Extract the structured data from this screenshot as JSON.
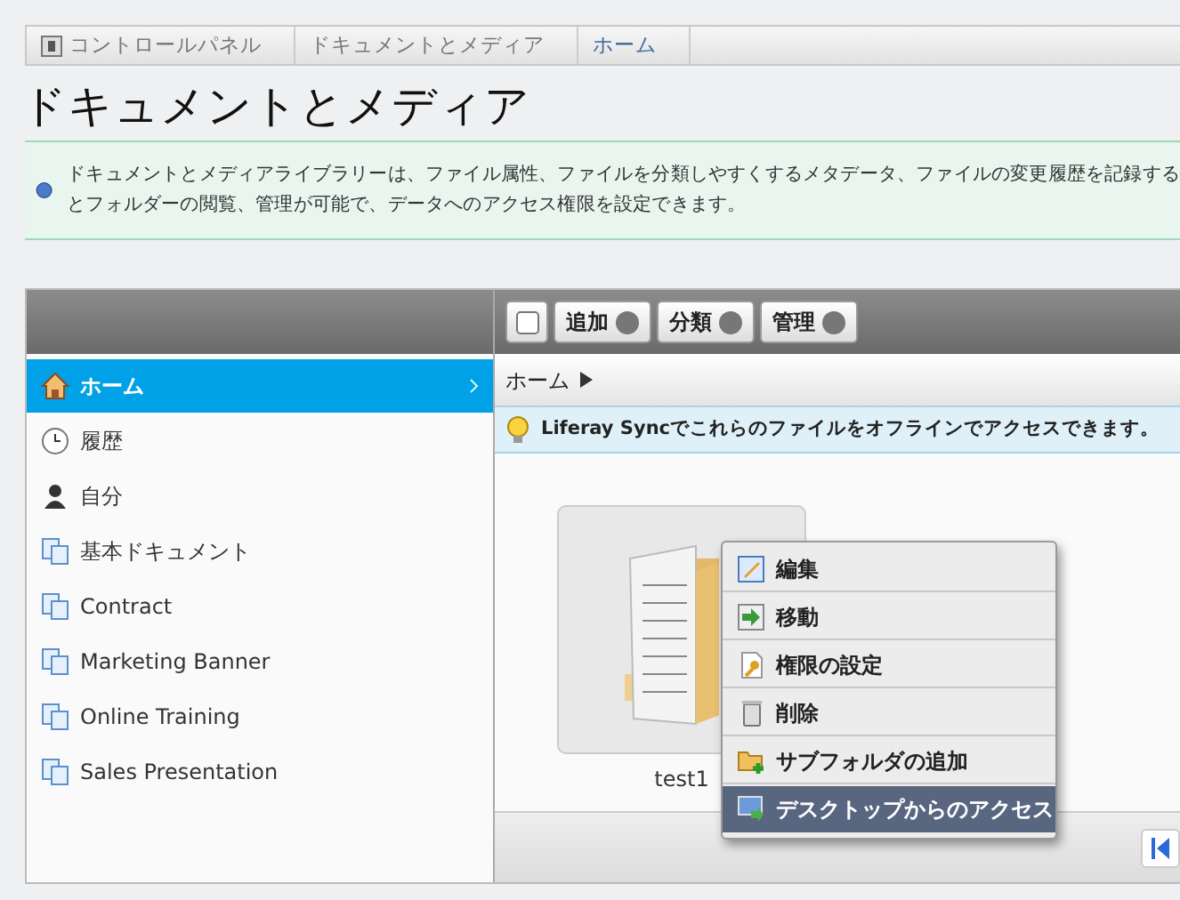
{
  "breadcrumb": [
    {
      "label": "コントロールパネル",
      "kind": "root",
      "current": false
    },
    {
      "label": "ドキュメントとメディア",
      "kind": "page",
      "current": false
    },
    {
      "label": "ホーム",
      "kind": "page",
      "current": true
    }
  ],
  "title": "ドキュメントとメディア",
  "info": {
    "lines": [
      "ドキュメントとメディアライブラリーは、ファイル属性、ファイルを分類しやすくするメタデータ、ファイルの変更履歴を記録する",
      "とフォルダーの閲覧、管理が可能で、データへのアクセス権限を設定できます。"
    ]
  },
  "toolbar": {
    "select_all": {
      "checked": false
    },
    "buttons": [
      "追加",
      "分類",
      "管理"
    ]
  },
  "sidebar": {
    "items": [
      {
        "label": "ホーム",
        "kind": "home",
        "selected": true
      },
      {
        "label": "履歴",
        "kind": "recent",
        "selected": false
      },
      {
        "label": "自分",
        "kind": "mine",
        "selected": false
      },
      {
        "label": "基本ドキュメント",
        "kind": "repository",
        "selected": false
      },
      {
        "label": "Contract",
        "kind": "repository",
        "selected": false
      },
      {
        "label": "Marketing Banner",
        "kind": "repository",
        "selected": false
      },
      {
        "label": "Online Training",
        "kind": "repository",
        "selected": false
      },
      {
        "label": "Sales Presentation",
        "kind": "repository",
        "selected": false
      }
    ]
  },
  "path": {
    "links": [
      "ホーム"
    ]
  },
  "sync_notice": "Liferay Syncでこれらのファイルをオフラインでアクセスできます。",
  "folders": [
    {
      "name": "test1"
    }
  ],
  "context_menu": [
    {
      "label": "編集",
      "kind": "edit",
      "selected": false
    },
    {
      "label": "移動",
      "kind": "move",
      "selected": false
    },
    {
      "label": "権限の設定",
      "kind": "permissions",
      "selected": false
    },
    {
      "label": "削除",
      "kind": "delete",
      "selected": false
    },
    {
      "label": "サブフォルダの追加",
      "kind": "add-folder",
      "selected": false
    },
    {
      "label": "デスクトップからのアクセス",
      "kind": "desktop",
      "selected": true
    }
  ]
}
